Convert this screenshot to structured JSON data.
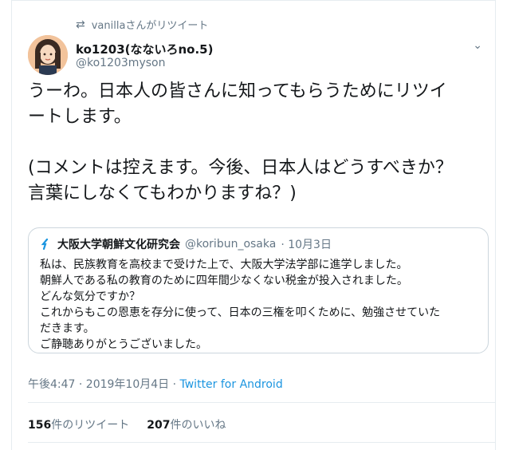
{
  "retweet": {
    "text": "vanillaさんがリツイート"
  },
  "author": {
    "name": "ko1203(なないろno.5)",
    "handle": "@ko1203myson"
  },
  "tweet": {
    "line1": "うーわ。日本人の皆さんに知ってもらうためにリツイ",
    "line2": "ートします。",
    "line3": "(コメントは控えます。今後、日本人はどうすべきか？",
    "line4": "言葉にしなくてもわかりますね？)"
  },
  "quote": {
    "name": "大阪大学朝鮮文化研究会",
    "handle": "@koribun_osaka",
    "date": "· 10月3日",
    "lines": [
      "私は、民族教育を高校まで受けた上で、大阪大学法学部に進学しました。",
      "朝鮮人である私の教育のために四年間少なくない税金が投入されました。",
      "どんな気分ですか？",
      "これからもこの恩恵を存分に使って、日本の三権を叩くために、勉強させていた",
      "だきます。",
      "ご静聴ありがとうございました。"
    ]
  },
  "meta": {
    "time": "午後4:47 · 2019年10月4日 · ",
    "source": "Twitter for Android"
  },
  "stats": {
    "retweets_count": "156",
    "retweets_label": "件のリツイート",
    "likes_count": "207",
    "likes_label": "件のいいね"
  },
  "colors": {
    "accent": "#1b95e0",
    "muted": "#657786",
    "text": "#14171a",
    "border": "#e6ecf0"
  }
}
